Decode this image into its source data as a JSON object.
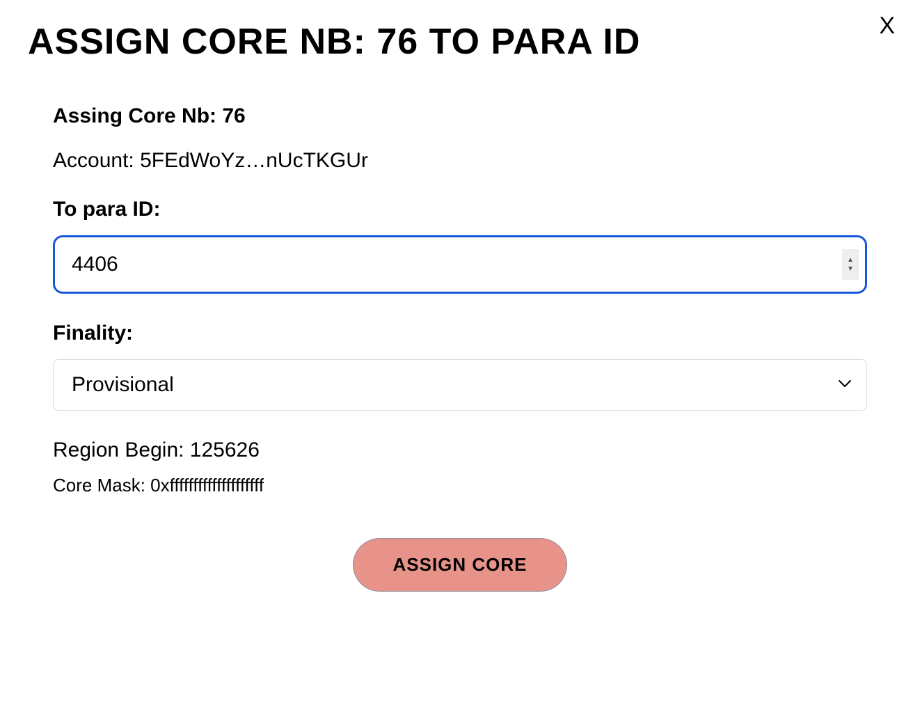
{
  "modal": {
    "title": "ASSIGN CORE NB: 76 TO PARA ID",
    "close_label": "X",
    "subtitle": "Assing Core Nb: 76",
    "account_line": "Account: 5FEdWoYz…nUcTKGUr",
    "para_id_label": "To para ID:",
    "para_id_value": "4406",
    "finality_label": "Finality:",
    "finality_value": "Provisional",
    "region_begin": "Region Begin: 125626",
    "core_mask": "Core Mask: 0xffffffffffffffffffff",
    "assign_button": "Assign Core"
  }
}
